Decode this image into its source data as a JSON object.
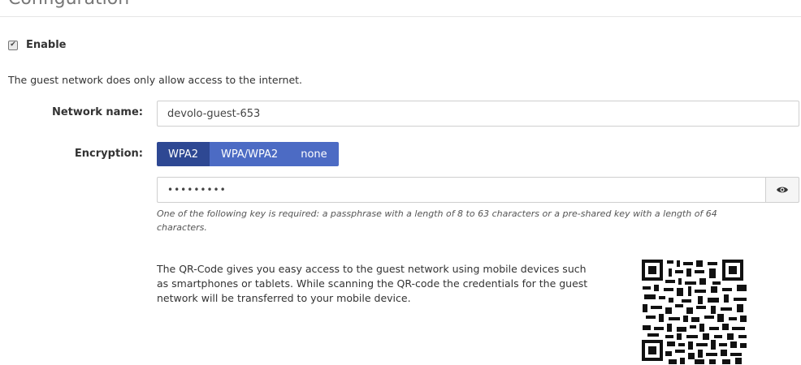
{
  "section": {
    "title": "Configuration"
  },
  "enable": {
    "label": "Enable",
    "checked": true,
    "check_glyph": "✔"
  },
  "info": {
    "text": "The guest network does only allow access to the internet."
  },
  "network_name": {
    "label": "Network name:",
    "value": "devolo-guest-653"
  },
  "encryption": {
    "label": "Encryption:",
    "options": [
      "WPA2",
      "WPA/WPA2",
      "none"
    ],
    "selected": "WPA2"
  },
  "key": {
    "masked_value": "•••••••••",
    "help": "One of the following key is required: a passphrase with a length of 8 to 63 characters or a pre-shared key with a length of 64 characters.",
    "reveal_icon": "eye-icon"
  },
  "qr": {
    "description": "The QR-Code gives you easy access to the guest network using mobile devices such as smartphones or tablets. While scanning the QR-code the credentials for the guest network will be transferred to your mobile device."
  },
  "colors": {
    "segment_active": "#2e4893",
    "segment_inactive": "#4c6bc4",
    "border": "#cfcfcf"
  }
}
